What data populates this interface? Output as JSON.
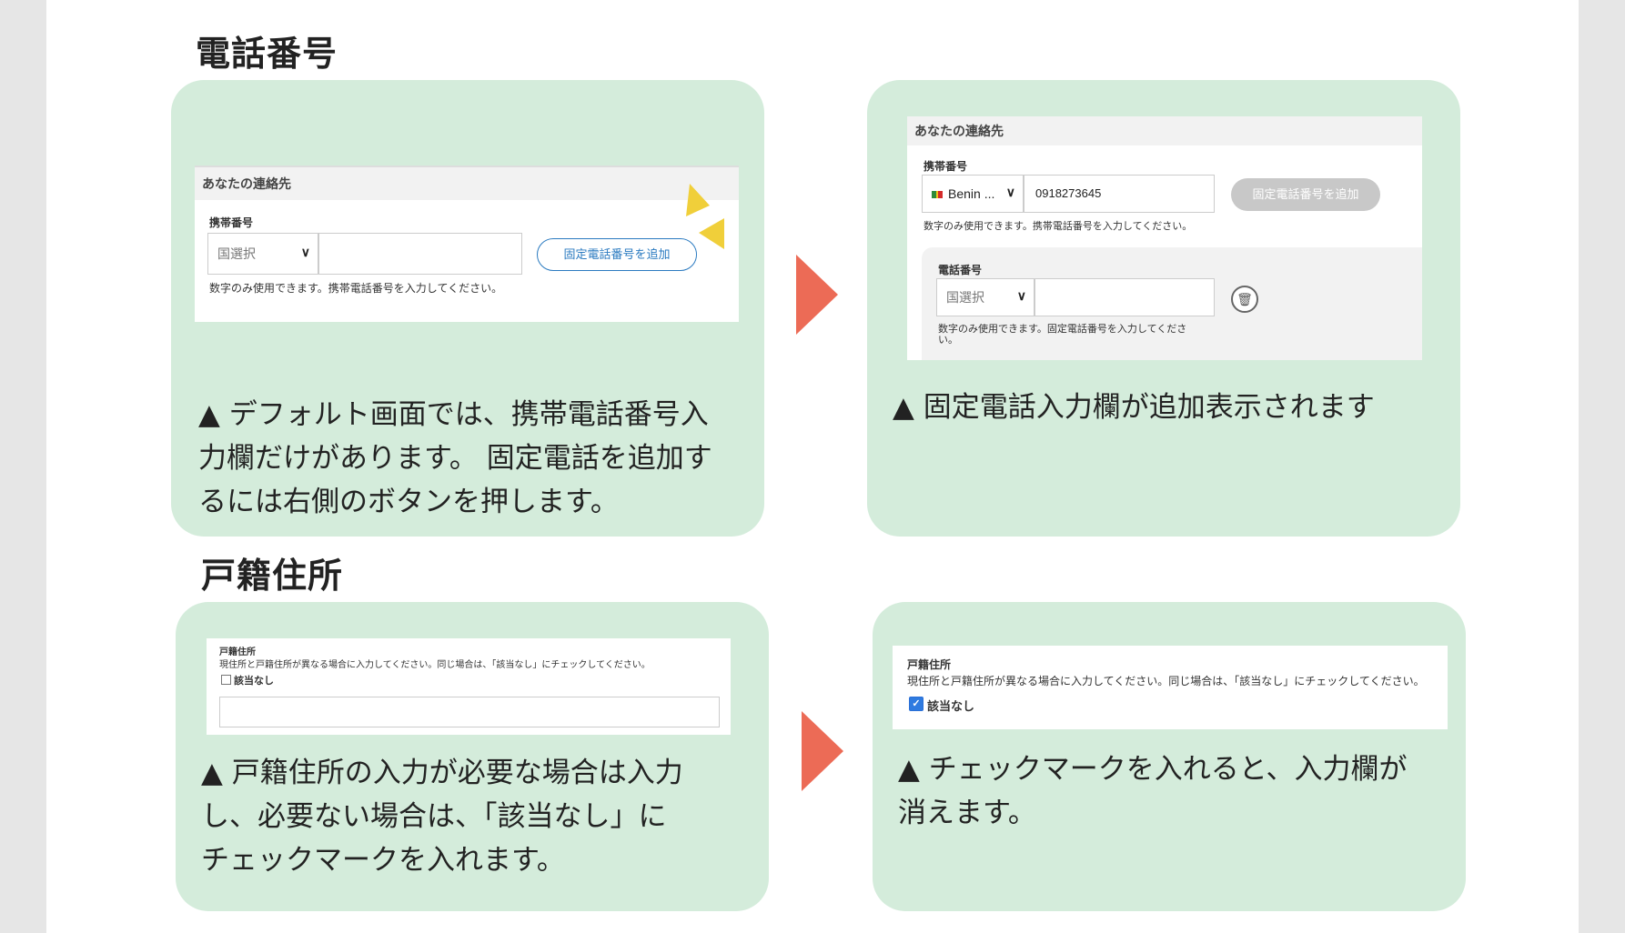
{
  "phone_section": {
    "title": "電話番号",
    "left": {
      "shot_header": "あなたの連絡先",
      "mobile_label": "携帯番号",
      "country_select": "国選択",
      "mobile_value": "",
      "add_landline_button": "固定電話番号を追加",
      "help": "数字のみ使用できます。携帯電話番号を入力してください。",
      "caption_lines": [
        "▲ デフォルト画面では、携帯電話番号入",
        "力欄だけがあります。 固定電話を追加す",
        "るには右側のボタンを押します。"
      ]
    },
    "right": {
      "shot_header": "あなたの連絡先",
      "mobile_label": "携帯番号",
      "country_select": "Benin ...",
      "mobile_value": "0918273645",
      "add_landline_button": "固定電話番号を追加",
      "help": "数字のみ使用できます。携帯電話番号を入力してください。",
      "landline_label": "電話番号",
      "landline_country": "国選択",
      "landline_value": "",
      "landline_help_line1": "数字のみ使用できます。固定電話番号を入力してくださ",
      "landline_help_line2": "い。",
      "caption": "▲ 固定電話入力欄が追加表示されます"
    }
  },
  "family_register_section": {
    "title": "戸籍住所",
    "left": {
      "label": "戸籍住所",
      "help": "現住所と戸籍住所が異なる場合に入力してください。同じ場合は、「該当なし」にチェックしてください。",
      "checkbox_label": "該当なし",
      "checked": false,
      "address_value": "",
      "caption_lines": [
        "▲ 戸籍住所の入力が必要な場合は入力",
        "し、必要ない場合は、「該当なし」に",
        "チェックマークを入れます。"
      ]
    },
    "right": {
      "label": "戸籍住所",
      "help": "現住所と戸籍住所が異なる場合に入力してください。同じ場合は、「該当なし」にチェックしてください。",
      "checkbox_label": "該当なし",
      "checked": true,
      "caption_lines": [
        "▲ チェックマークを入れると、入力欄が",
        "消えます。"
      ]
    }
  },
  "colors": {
    "card_bg": "#d4ecdb",
    "arrow": "#ec6b56",
    "button_blue": "#2a7ac0",
    "disabled_button": "#c8c8c8",
    "highlight": "#f0cf3a"
  }
}
